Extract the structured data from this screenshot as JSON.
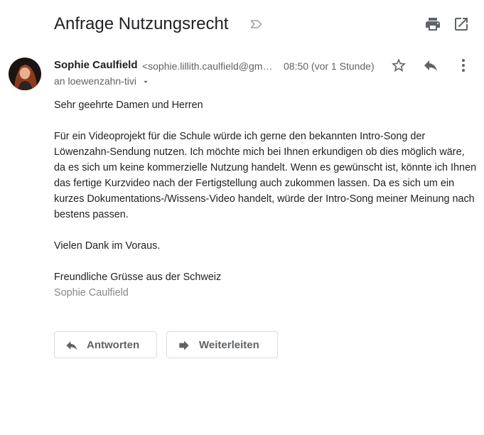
{
  "email": {
    "subject": "Anfrage Nutzungsrecht",
    "sender_name": "Sophie Caulfield",
    "sender_email": "<sophie.lillith.caulfield@gmail.com>",
    "timestamp": "08:50 (vor 1 Stunde)",
    "recipient": "an loewenzahn-tivi",
    "body": {
      "greeting": "Sehr geehrte Damen und Herren",
      "paragraph": "Für ein Videoprojekt für die Schule würde ich gerne den bekannten Intro-Song der Löwenzahn-Sendung nutzen. Ich möchte mich bei Ihnen erkundigen ob dies möglich wäre, da es sich um keine kommerzielle Nutzung handelt. Wenn es gewünscht ist, könnte ich Ihnen das fertige Kurzvideo nach der Fertigstellung auch zukommen lassen. Da es sich um ein kurzes Dokumentations-/Wissens-Video handelt, würde der Intro-Song meiner Meinung nach bestens passen.",
      "thanks": "Vielen Dank im Voraus.",
      "closing": "Freundliche Grüsse aus der Schweiz",
      "signature": "Sophie Caulfield"
    }
  },
  "actions": {
    "reply_label": "Antworten",
    "forward_label": "Weiterleiten"
  },
  "icons": {
    "label": "label-outline-icon",
    "print": "print-icon",
    "open_new_window": "open-in-new-window-icon",
    "star": "star-outline-icon",
    "reply": "reply-icon",
    "more": "more-vertical-icon",
    "dropdown": "dropdown-arrow-icon",
    "forward": "forward-arrow-icon"
  },
  "colors": {
    "icon_gray": "#5f6368",
    "border": "#dadce0",
    "signature_gray": "#888888"
  }
}
